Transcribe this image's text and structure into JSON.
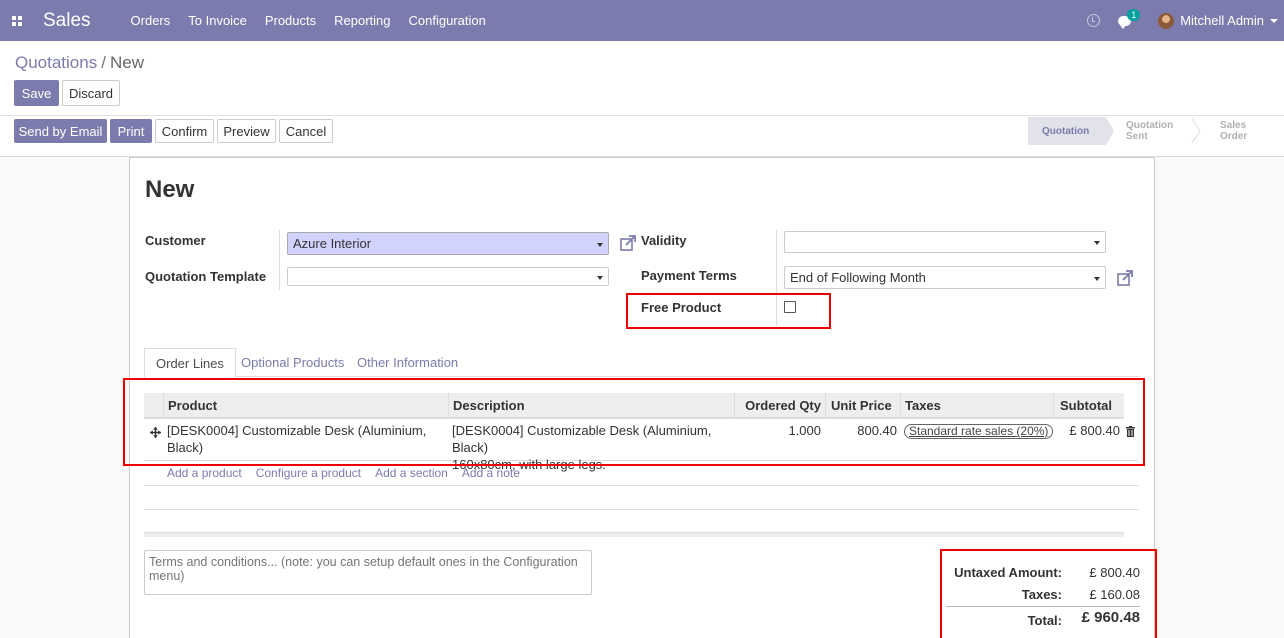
{
  "navbar": {
    "app_name": "Sales",
    "menu": [
      "Orders",
      "To Invoice",
      "Products",
      "Reporting",
      "Configuration"
    ],
    "chat_badge": "1",
    "user_name": "Mitchell Admin"
  },
  "breadcrumb": {
    "parent": "Quotations",
    "separator": "/",
    "current": "New"
  },
  "buttons": {
    "save": "Save",
    "discard": "Discard",
    "send_email": "Send by Email",
    "print": "Print",
    "confirm": "Confirm",
    "preview": "Preview",
    "cancel": "Cancel"
  },
  "statusbar": [
    "Quotation",
    "Quotation Sent",
    "Sales Order"
  ],
  "form": {
    "title": "New",
    "customer_label": "Customer",
    "customer_value": "Azure Interior",
    "template_label": "Quotation Template",
    "template_value": "",
    "validity_label": "Validity",
    "validity_value": "",
    "payment_terms_label": "Payment Terms",
    "payment_terms_value": "End of Following Month",
    "free_product_label": "Free Product"
  },
  "tabs": [
    "Order Lines",
    "Optional Products",
    "Other Information"
  ],
  "table": {
    "headers": [
      "Product",
      "Description",
      "Ordered Qty",
      "Unit Price",
      "Taxes",
      "Subtotal"
    ],
    "rows": [
      {
        "product": "[DESK0004] Customizable Desk (Aluminium, Black)",
        "description_line1": "[DESK0004] Customizable Desk (Aluminium, Black)",
        "description_line2": "160x80cm, with large legs.",
        "qty": "1.000",
        "unit_price": "800.40",
        "tax": "Standard rate sales (20%)",
        "subtotal": "£ 800.40"
      }
    ],
    "add_links": [
      "Add a product",
      "Configure a product",
      "Add a section",
      "Add a note"
    ]
  },
  "terms_placeholder": "Terms and conditions... (note: you can setup default ones in the Configuration menu)",
  "totals": {
    "untaxed_label": "Untaxed Amount:",
    "untaxed_value": "£ 800.40",
    "taxes_label": "Taxes:",
    "taxes_value": "£ 160.08",
    "total_label": "Total:",
    "total_value": "£ 960.48"
  }
}
